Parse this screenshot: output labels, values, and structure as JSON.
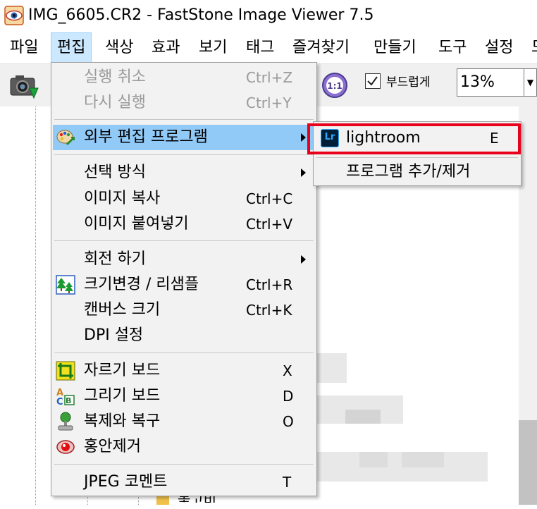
{
  "window": {
    "title": "IMG_6605.CR2  -  FastStone Image Viewer 7.5"
  },
  "menubar": {
    "items": [
      {
        "label": "파일"
      },
      {
        "label": "편집"
      },
      {
        "label": "색상"
      },
      {
        "label": "효과"
      },
      {
        "label": "보기"
      },
      {
        "label": "태그"
      },
      {
        "label": "즐겨찾기"
      },
      {
        "label": "만들기"
      },
      {
        "label": "도구"
      },
      {
        "label": "설정"
      },
      {
        "label": "도"
      }
    ]
  },
  "toolbar": {
    "smooth_label": "부드럽게",
    "smooth_checked": true,
    "zoom_value": "13%"
  },
  "edit_menu": {
    "items": [
      {
        "label": "실행 취소",
        "shortcut": "Ctrl+Z",
        "enabled": false
      },
      {
        "label": "다시 실행",
        "shortcut": "Ctrl+Y",
        "enabled": false
      },
      {
        "label": "외부 편집 프로그램",
        "shortcut": "",
        "submenu": true,
        "icon": "palette-icon",
        "highlighted": true
      },
      {
        "label": "선택 방식",
        "shortcut": "",
        "submenu": true
      },
      {
        "label": "이미지 복사",
        "shortcut": "Ctrl+C"
      },
      {
        "label": "이미지 붙여넣기",
        "shortcut": "Ctrl+V"
      },
      {
        "label": "회전 하기",
        "shortcut": "",
        "submenu": true
      },
      {
        "label": "크기변경 / 리샘플",
        "shortcut": "Ctrl+R",
        "icon": "resize-trees-icon"
      },
      {
        "label": "캔버스 크기",
        "shortcut": "Ctrl+K"
      },
      {
        "label": "DPI 설정",
        "shortcut": ""
      },
      {
        "label": "자르기 보드",
        "shortcut": "X",
        "icon": "crop-icon"
      },
      {
        "label": "그리기 보드",
        "shortcut": "D",
        "icon": "draw-board-icon"
      },
      {
        "label": "복제와 복구",
        "shortcut": "O",
        "icon": "clone-stamp-icon"
      },
      {
        "label": "홍안제거",
        "shortcut": "",
        "icon": "red-eye-icon"
      },
      {
        "label": "JPEG 코멘트",
        "shortcut": "T"
      }
    ]
  },
  "external_submenu": {
    "items": [
      {
        "label": "lightroom",
        "shortcut": "E",
        "icon": "lightroom-icon",
        "icon_text": "Lr"
      },
      {
        "label": "프로그램 추가/제거",
        "shortcut": ""
      }
    ]
  },
  "folder_tree": {
    "partial_label": "놓고비"
  },
  "colors": {
    "menu_highlight": "#91c9f7",
    "menubar_active": "#cce8ff",
    "annotation_box": "#e8001c",
    "lightroom_bg": "#001e36",
    "lightroom_accent": "#31a8ff"
  }
}
